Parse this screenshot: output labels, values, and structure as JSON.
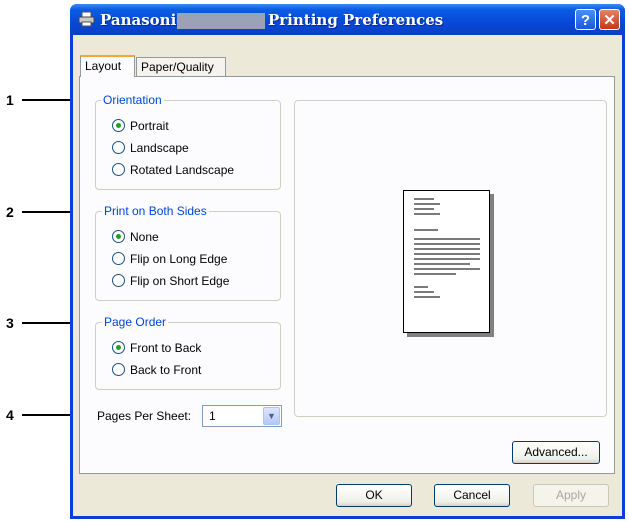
{
  "window": {
    "title_left": "Panasonic",
    "title_right": "Printing Preferences",
    "help_glyph": "?",
    "close_glyph": "✕"
  },
  "tabs": [
    {
      "label": "Layout"
    },
    {
      "label": "Paper/Quality"
    }
  ],
  "callouts": [
    "1",
    "2",
    "3",
    "4"
  ],
  "orientation": {
    "label": "Orientation",
    "options": [
      {
        "label": "Portrait",
        "selected": true
      },
      {
        "label": "Landscape",
        "selected": false
      },
      {
        "label": "Rotated Landscape",
        "selected": false
      }
    ]
  },
  "both_sides": {
    "label": "Print on Both Sides",
    "options": [
      {
        "label": "None",
        "selected": true
      },
      {
        "label": "Flip on Long Edge",
        "selected": false
      },
      {
        "label": "Flip on Short Edge",
        "selected": false
      }
    ]
  },
  "page_order": {
    "label": "Page Order",
    "options": [
      {
        "label": "Front to Back",
        "selected": true
      },
      {
        "label": "Back to Front",
        "selected": false
      }
    ]
  },
  "pages_per_sheet": {
    "label": "Pages Per Sheet:",
    "value": "1",
    "arrow": "▼"
  },
  "buttons": {
    "advanced": "Advanced...",
    "ok": "OK",
    "cancel": "Cancel",
    "apply": "Apply"
  },
  "colors": {
    "title_bar": "#0a5de3",
    "group_label": "#0046d5",
    "tab_highlight": "#f2a73c",
    "radio_dot": "#21a121"
  },
  "icons": {
    "title": "printer-icon",
    "help": "help-icon",
    "close": "close-icon",
    "dropdown": "chevron-down-icon"
  }
}
